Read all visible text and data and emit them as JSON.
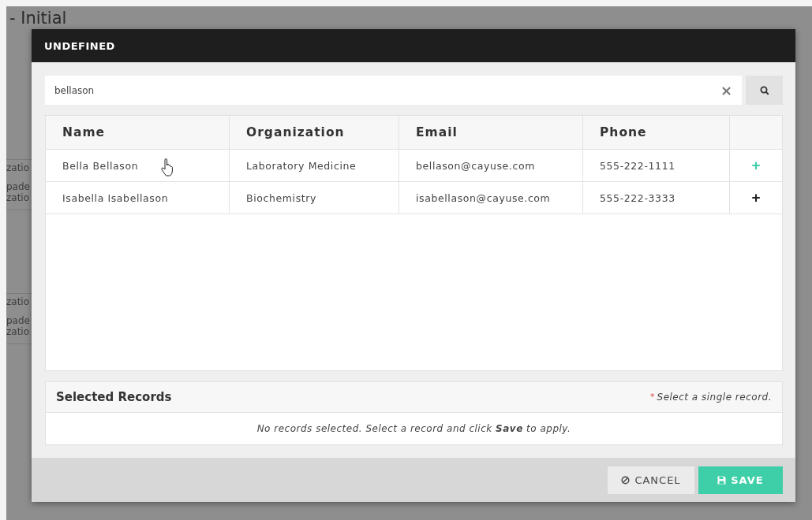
{
  "page": {
    "heading": "- Initial",
    "fragments": [
      "zatio",
      "pade",
      "zatio",
      "zatio",
      "pade",
      "zatio"
    ]
  },
  "dialog": {
    "title": "UNDEFINED",
    "search": {
      "value": "bellason",
      "clear": "×"
    },
    "table": {
      "columns": [
        "Name",
        "Organization",
        "Email",
        "Phone"
      ],
      "rows": [
        {
          "cells": [
            "Bella Bellason",
            "Laboratory Medicine",
            "bellason@cayuse.com",
            "555-222-1111"
          ],
          "add": "+",
          "hovered": true
        },
        {
          "cells": [
            "Isabella Isabellason",
            "Biochemistry",
            "isabellason@cayuse.com",
            "555-222-3333"
          ],
          "add": "+",
          "hovered": false
        }
      ]
    },
    "selected_records": {
      "title": "Selected Records",
      "required_mark": "*",
      "hint": "Select a single record.",
      "empty_message": "No records selected. Select a record and click **Save** to apply."
    },
    "buttons": [
      {
        "label": "CANCEL",
        "kind": "cancel"
      },
      {
        "label": "SAVE",
        "kind": "save"
      }
    ]
  }
}
